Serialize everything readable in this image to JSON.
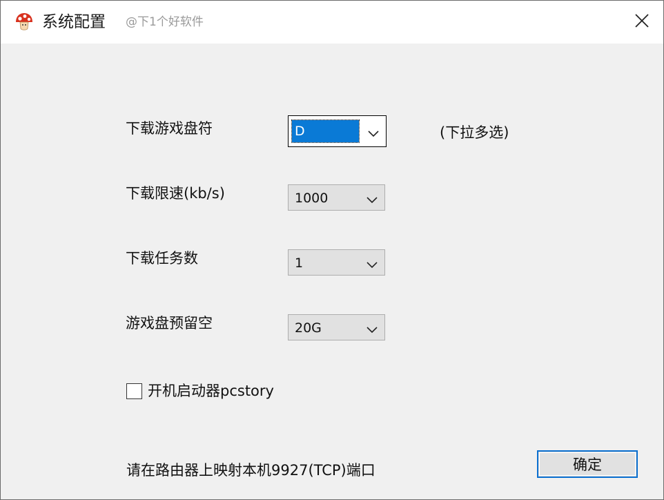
{
  "window": {
    "title": "系统配置",
    "watermark": "@下1个好软件",
    "close_icon": "close-icon",
    "app_icon": "mushroom-icon"
  },
  "form": {
    "drive": {
      "label": "下载游戏盘符",
      "value": "D",
      "hint": "(下拉多选)"
    },
    "speed_limit": {
      "label": "下载限速(kb/s)",
      "value": "1000"
    },
    "task_count": {
      "label": "下载任务数",
      "value": "1"
    },
    "reserved_space": {
      "label": "游戏盘预留空",
      "value": "20G"
    },
    "autostart": {
      "label": "开机启动器pcstory",
      "checked": false
    }
  },
  "footer": {
    "note": "请在路由器上映射本机9927(TCP)端口",
    "ok_label": "确定"
  },
  "colors": {
    "selection": "#0a7ad6",
    "button_focus_border": "#0a6fd0",
    "combo_background": "#e1e1e1",
    "window_background": "#f0f0f0"
  }
}
